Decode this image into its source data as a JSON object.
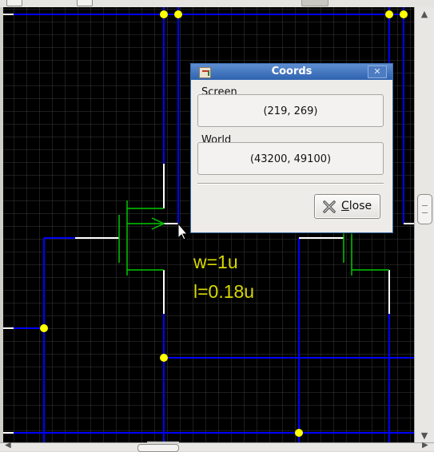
{
  "dialog": {
    "title": "Coords",
    "screen_label": "Screen",
    "screen_value": "(219, 269)",
    "world_label": "World",
    "world_value": "(43200, 49100)",
    "close_button": {
      "mnemonic": "C",
      "rest": "lose"
    }
  },
  "schematic": {
    "annotations": {
      "width": "w=1u",
      "length": "l=0.18u"
    },
    "colors": {
      "background": "#000000",
      "grid": "#3a3a3a",
      "wire": "#0000ff",
      "pin": "#ffffff",
      "device": "#00c800",
      "junction": "#ffff00",
      "label": "#d8d800"
    }
  },
  "icons": {
    "app": "app-icon",
    "close_x": "close-x-icon",
    "close_button": "close-x-icon",
    "pointer": "mouse-pointer-icon",
    "scroll_up": "arrow-up-icon",
    "scroll_down": "arrow-down-icon",
    "scroll_left": "arrow-left-icon",
    "scroll_right": "arrow-right-icon"
  }
}
